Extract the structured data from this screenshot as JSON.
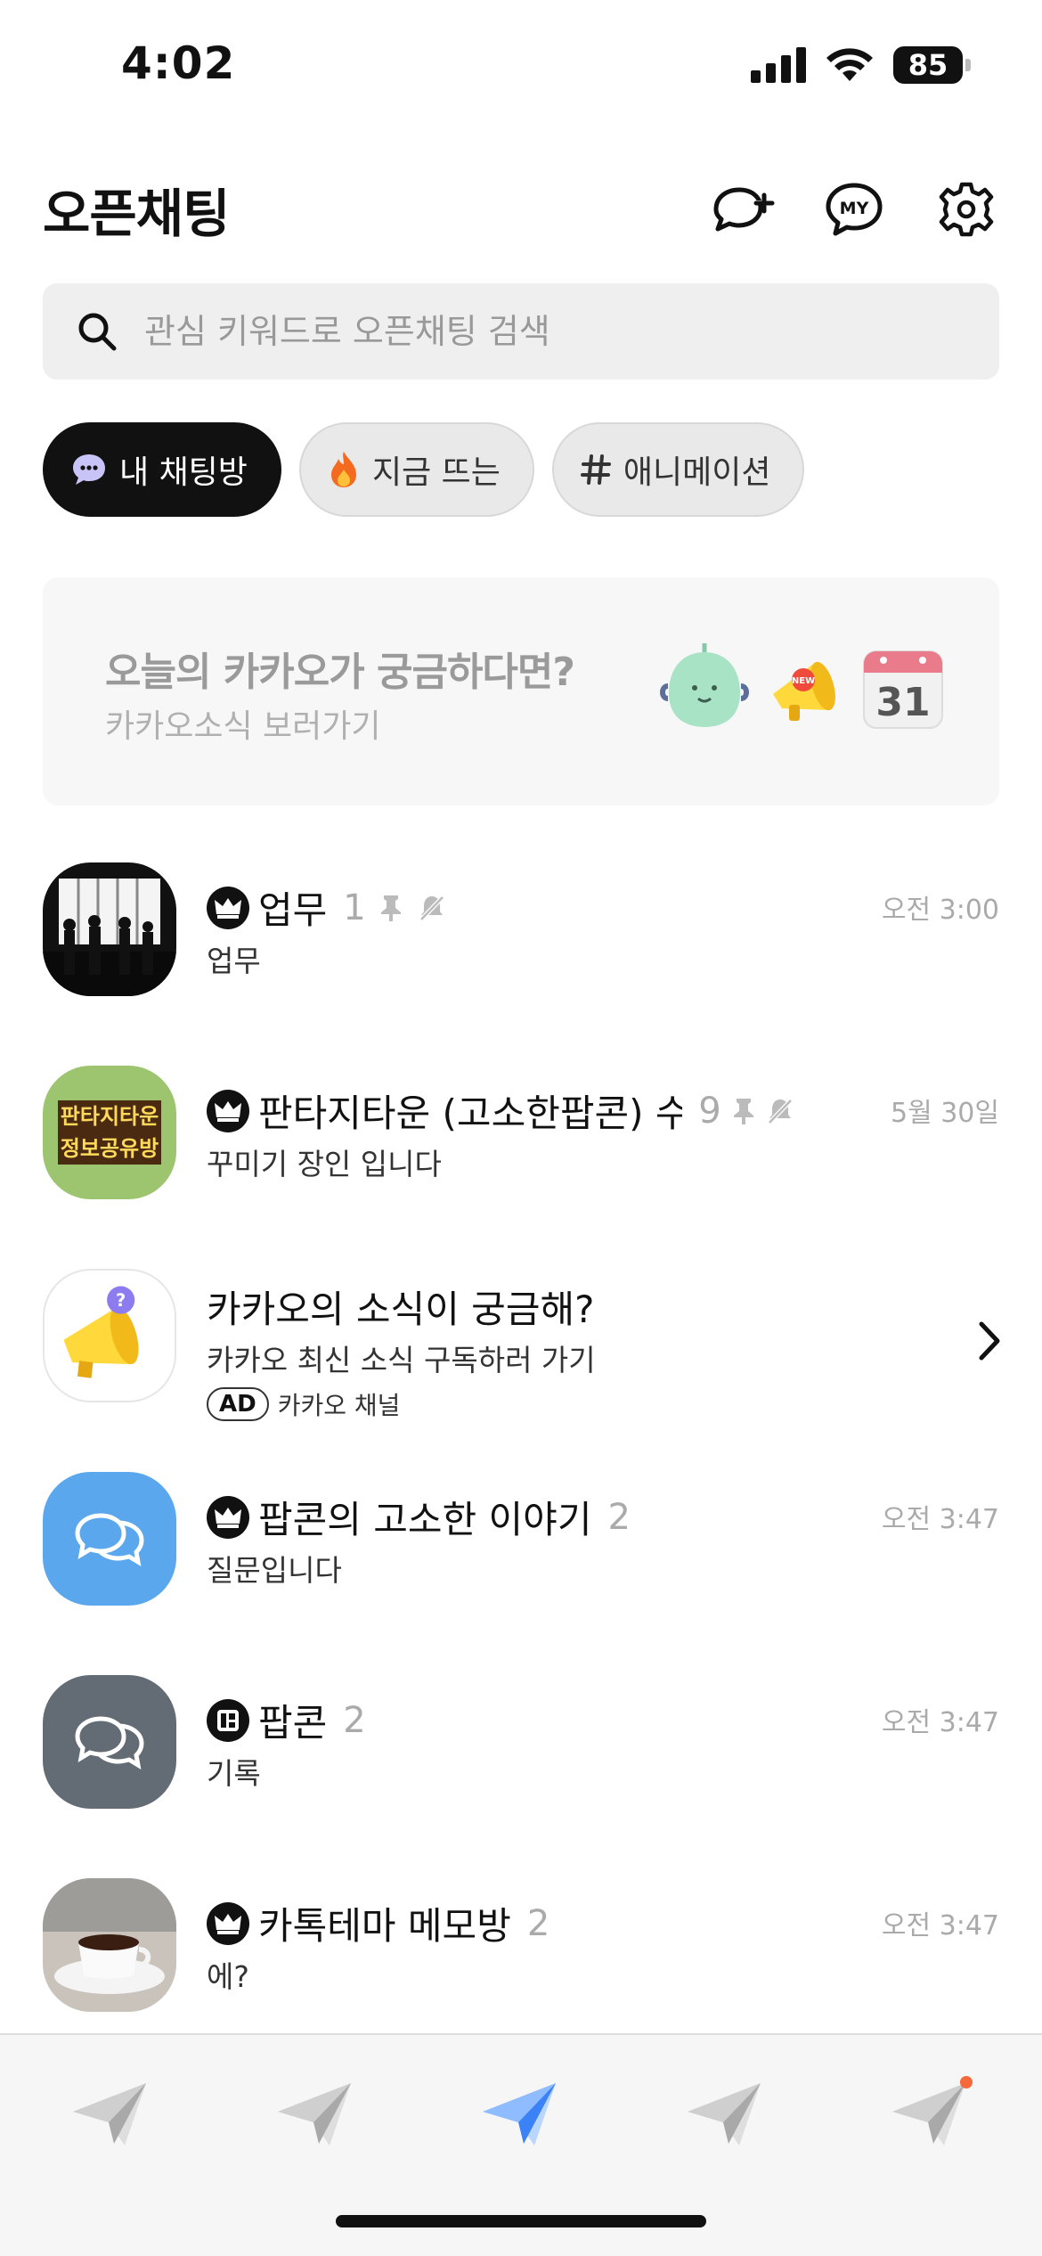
{
  "status_bar": {
    "time": "4:02",
    "battery": "85"
  },
  "header": {
    "title": "오픈채팅"
  },
  "search": {
    "placeholder": "관심 키워드로 오픈채팅 검색"
  },
  "chips": [
    {
      "label": "내 채팅방",
      "icon": "chat-bubble-icon",
      "active": true
    },
    {
      "label": "지금 뜨는",
      "icon": "fire-icon",
      "active": false
    },
    {
      "label": "애니메이션",
      "icon": "hashtag-icon",
      "active": false
    }
  ],
  "banner": {
    "title": "오늘의 카카오가 궁금하다면?",
    "subtitle": "카카오소식 보러가기",
    "calendar_day": "31",
    "megaphone_tag": "NEW"
  },
  "chats": [
    {
      "name": "업무",
      "count": "1",
      "message": "업무",
      "time": "오전 3:00"
    },
    {
      "name": "판타지타운 (고소한팝콘) 수다…",
      "count": "9",
      "message": "꾸미기 장인 입니다",
      "time": "5월 30일",
      "avatar_text_1": "판타지타운",
      "avatar_text_2": "정보공유방"
    },
    {
      "name": "카카오의 소식이 궁금해?",
      "message": "카카오 최신 소식 구독하러 가기",
      "ad_tag": "AD",
      "ad_channel": "카카오 채널"
    },
    {
      "name": "팝콘의 고소한 이야기",
      "count": "2",
      "message": "질문입니다",
      "time": "오전 3:47"
    },
    {
      "name": "팝콘",
      "count": "2",
      "message": "기록",
      "time": "오전 3:47"
    },
    {
      "name": "카톡테마 메모방",
      "count": "2",
      "message": "에?",
      "time": "오전 3:47"
    }
  ],
  "colors": {
    "accent_blue": "#3b82f6",
    "chat_blue": "#5aa7ee",
    "chat_gray": "#636b75",
    "notification_dot": "#f5693a"
  },
  "tab_bar": {
    "active_index": 2,
    "tabs": [
      "paper-plane-icon",
      "paper-plane-icon",
      "paper-plane-icon",
      "paper-plane-icon",
      "paper-plane-icon"
    ]
  }
}
